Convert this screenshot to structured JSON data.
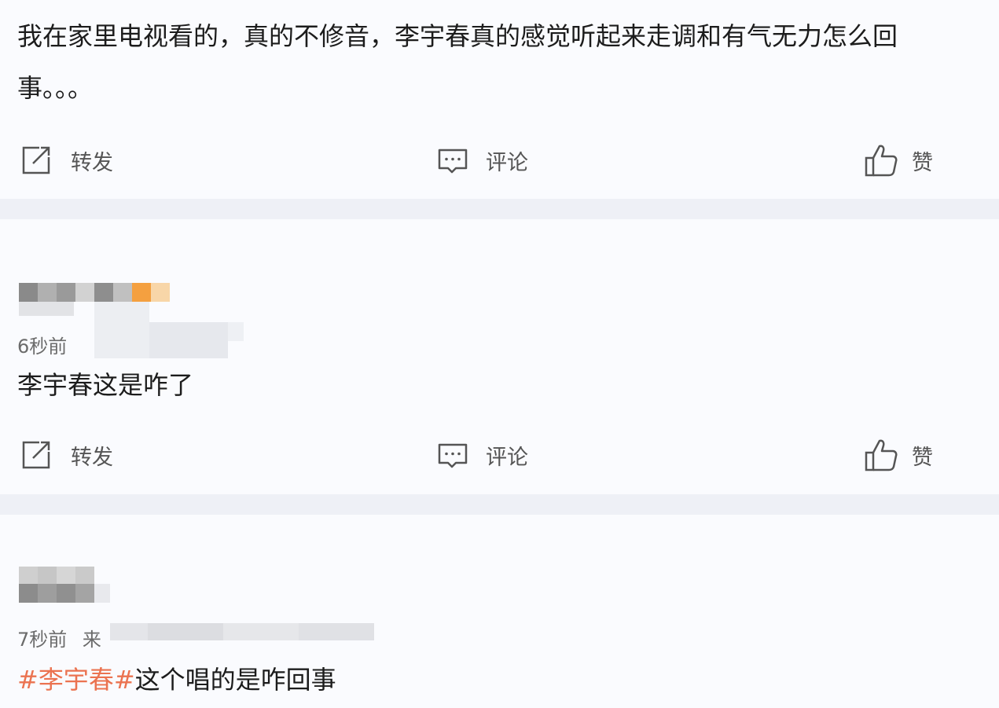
{
  "post1": {
    "line1": "我在家里电视看的，真的不修音，李宇春真的感觉听起来走调和有气无力怎么回",
    "line2": "事。。。",
    "actions": {
      "repost": "转发",
      "comment": "评论",
      "like": "赞"
    }
  },
  "comment1": {
    "time": "6秒前",
    "text": "李宇春这是咋了",
    "actions": {
      "repost": "转发",
      "comment": "评论",
      "like": "赞"
    }
  },
  "comment2": {
    "time": "7秒前",
    "source_prefix": "来",
    "hashtag": "#李宇春#",
    "text": "这个唱的是咋回事"
  },
  "icons": {
    "repost": "repost-icon",
    "comment": "comment-icon",
    "like": "thumbs-up-icon"
  },
  "colors": {
    "hashtag": "#eb7350",
    "text": "#1c1c1c",
    "meta": "#6b6b6b"
  }
}
